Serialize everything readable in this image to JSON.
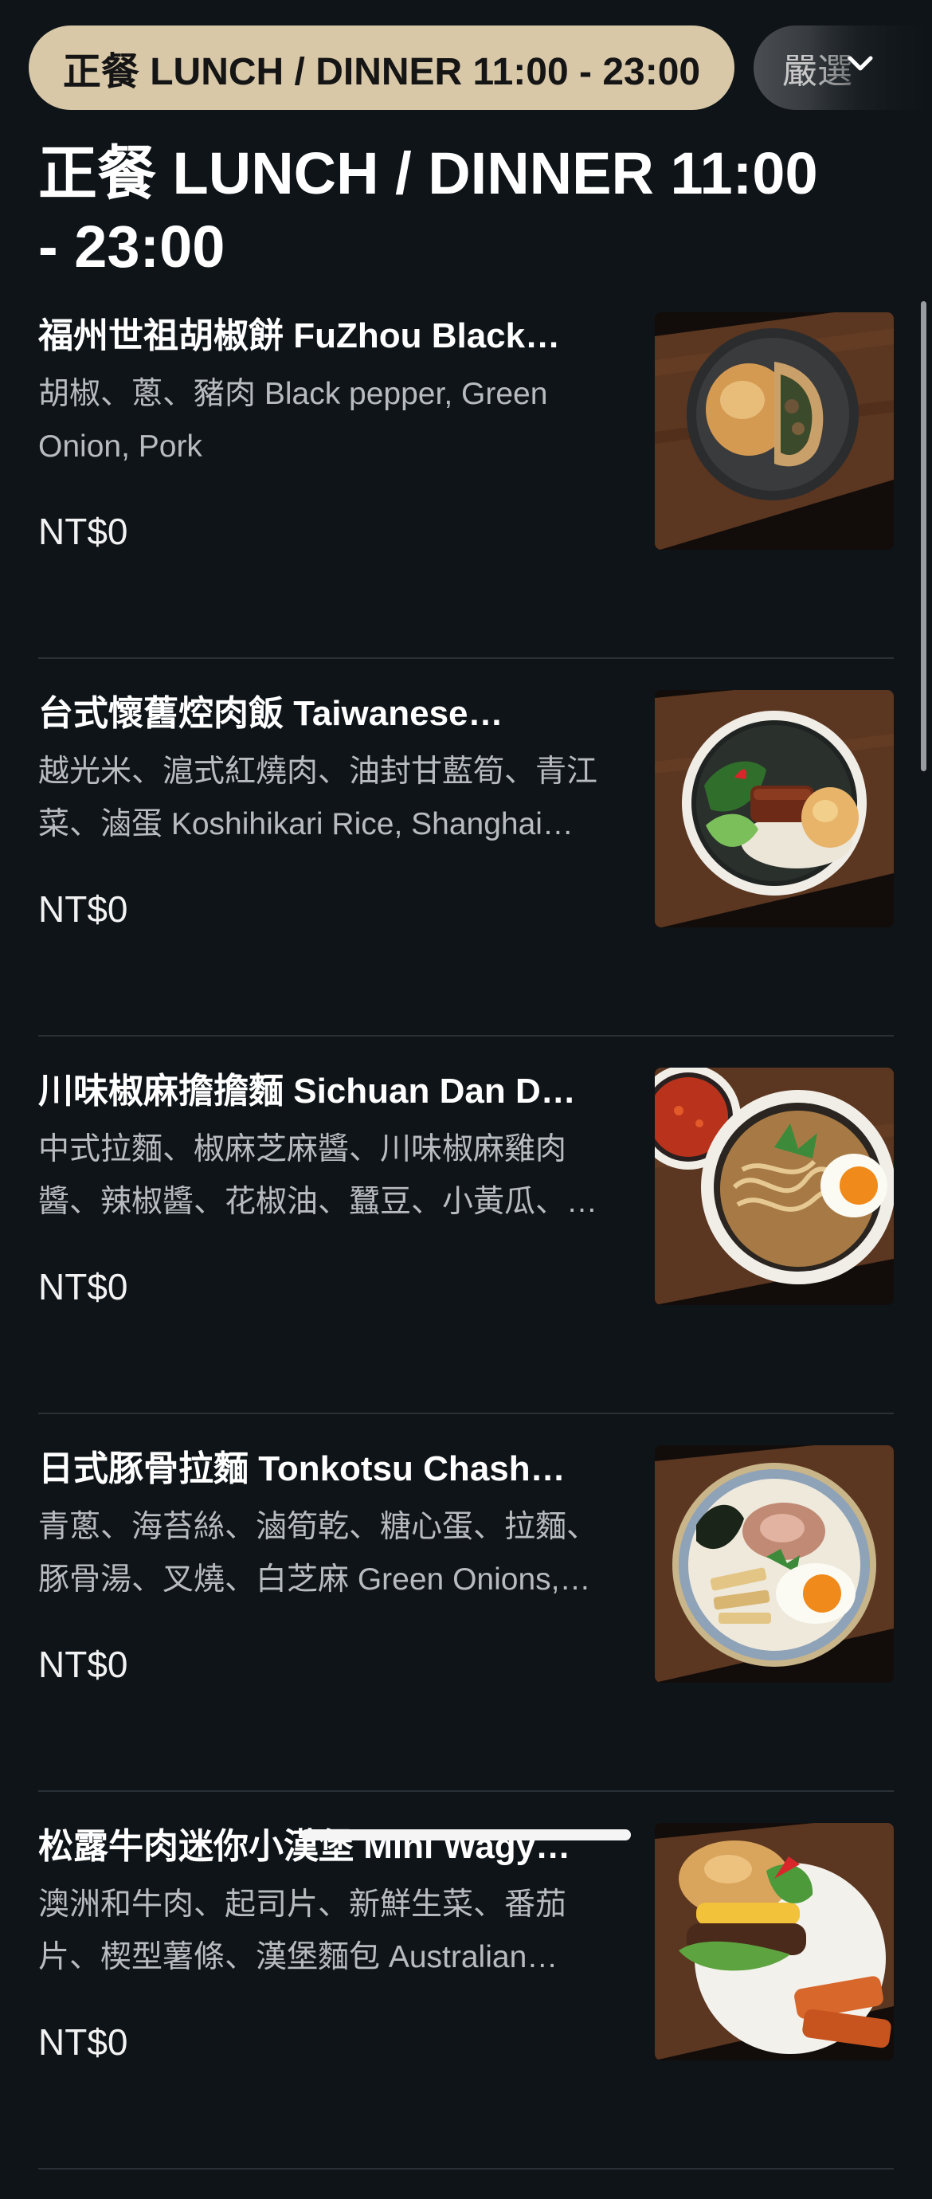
{
  "tabs": [
    {
      "label": "正餐 LUNCH / DINNER 11:00 - 23:00",
      "active": true
    },
    {
      "label": "嚴選",
      "active": false
    }
  ],
  "section": {
    "title": "正餐 LUNCH / DINNER 11:00 - 23:00"
  },
  "menu": {
    "items": [
      {
        "name": "福州世祖胡椒餅 FuZhou Black…",
        "description": "胡椒、蔥、豬肉 Black pepper, Green Onion, Pork",
        "price": "NT$0",
        "photo": "pepper-bun-photo"
      },
      {
        "name": "台式懷舊焢肉飯 Taiwanese…",
        "description": "越光米、滬式紅燒肉、油封甘藍筍、青江菜、滷蛋 Koshihikari Rice, Shanghai…",
        "price": "NT$0",
        "photo": "braised-pork-rice-photo"
      },
      {
        "name": "川味椒麻擔擔麵 Sichuan Dan D…",
        "description": "中式拉麵、椒麻芝麻醬、川味椒麻雞肉醬、辣椒醬、花椒油、蠶豆、小黃瓜、…",
        "price": "NT$0",
        "photo": "dan-dan-noodles-photo"
      },
      {
        "name": "日式豚骨拉麵 Tonkotsu Chash…",
        "description": "青蔥、海苔絲、滷筍乾、糖心蛋、拉麵、豚骨湯、叉燒、白芝麻 Green Onions,…",
        "price": "NT$0",
        "photo": "tonkotsu-ramen-photo"
      },
      {
        "name": "松露牛肉迷你小漢堡 Mini Wagy…",
        "description": "澳洲和牛肉、起司片、新鮮生菜、番茄片、楔型薯條、漢堡麵包 Australian…",
        "price": "NT$0",
        "photo": "mini-wagyu-burger-photo"
      }
    ]
  },
  "colors": {
    "background": "#0e1418",
    "active_tab": "#d8c8a8",
    "divider": "#2a3136"
  },
  "icons": {
    "tab_dropdown": "chevron-down-icon"
  }
}
